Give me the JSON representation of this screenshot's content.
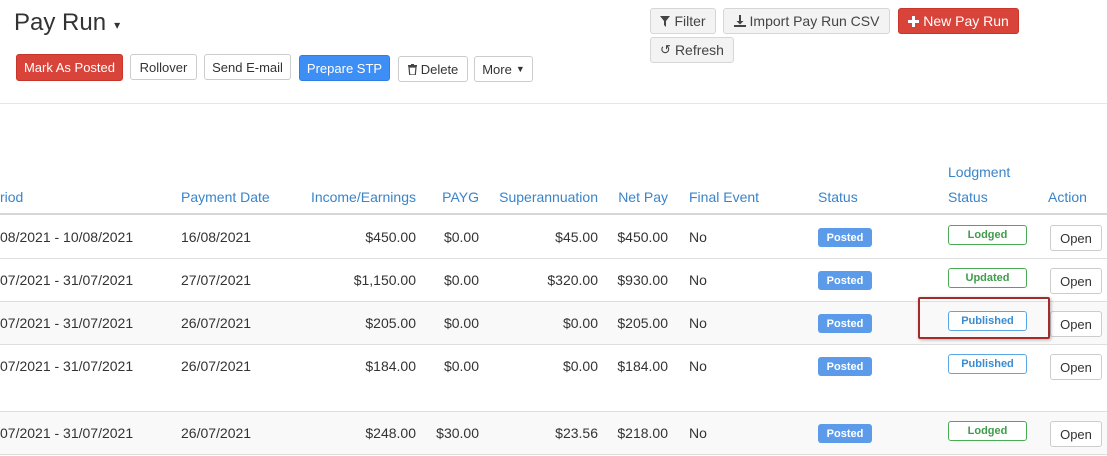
{
  "header": {
    "title": "Pay Run",
    "title_caret": "▾"
  },
  "toolbar": {
    "filter": "Filter",
    "import": "Import Pay Run CSV",
    "new_pay_run": "New Pay Run",
    "refresh": "Refresh"
  },
  "actions": {
    "mark_as_posted": "Mark As Posted",
    "rollover": "Rollover",
    "send_email": "Send E-mail",
    "prepare_stp": "Prepare STP",
    "delete": "Delete",
    "more": "More"
  },
  "columns": {
    "period": "riod",
    "payment_date": "Payment Date",
    "income": "Income/Earnings",
    "payg": "PAYG",
    "super": "Superannuation",
    "net_pay": "Net Pay",
    "final_event": "Final Event",
    "status": "Status",
    "lodgment_line1": "Lodgment",
    "lodgment_line2": "Status",
    "action": "Action"
  },
  "rows": [
    {
      "period": "08/2021 - 10/08/2021",
      "payment_date": "16/08/2021",
      "income": "$450.00",
      "payg": "$0.00",
      "super": "$45.00",
      "net_pay": "$450.00",
      "final_event": "No",
      "status": "Posted",
      "lodgment": "Lodged",
      "action": "Open"
    },
    {
      "period": "07/2021 - 31/07/2021",
      "payment_date": "27/07/2021",
      "income": "$1,150.00",
      "payg": "$0.00",
      "super": "$320.00",
      "net_pay": "$930.00",
      "final_event": "No",
      "status": "Posted",
      "lodgment": "Updated",
      "action": "Open"
    },
    {
      "period": "07/2021 - 31/07/2021",
      "payment_date": "26/07/2021",
      "income": "$205.00",
      "payg": "$0.00",
      "super": "$0.00",
      "net_pay": "$205.00",
      "final_event": "No",
      "status": "Posted",
      "lodgment": "Published",
      "action": "Open"
    },
    {
      "period": "07/2021 - 31/07/2021",
      "payment_date": "26/07/2021",
      "income": "$184.00",
      "payg": "$0.00",
      "super": "$0.00",
      "net_pay": "$184.00",
      "final_event": "No",
      "status": "Posted",
      "lodgment": "Published",
      "action": "Open"
    },
    {
      "period": "07/2021 - 31/07/2021",
      "payment_date": "26/07/2021",
      "income": "$248.00",
      "payg": "$30.00",
      "super": "$23.56",
      "net_pay": "$218.00",
      "final_event": "No",
      "status": "Posted",
      "lodgment": "Lodged",
      "action": "Open"
    }
  ],
  "colors": {
    "accent_red": "#d9443a",
    "accent_blue": "#3d8ef5",
    "header_link": "#3a84c9",
    "posted_badge": "#5b9bea",
    "lodged_green": "#4aab55",
    "published_blue": "#5ba7e6",
    "highlight_box": "#a52a2a"
  },
  "icons": {
    "filter": "filter-icon",
    "import": "download-icon",
    "new": "plus-icon",
    "refresh": "refresh-icon",
    "delete": "trash-icon",
    "more": "caret-down-icon"
  }
}
